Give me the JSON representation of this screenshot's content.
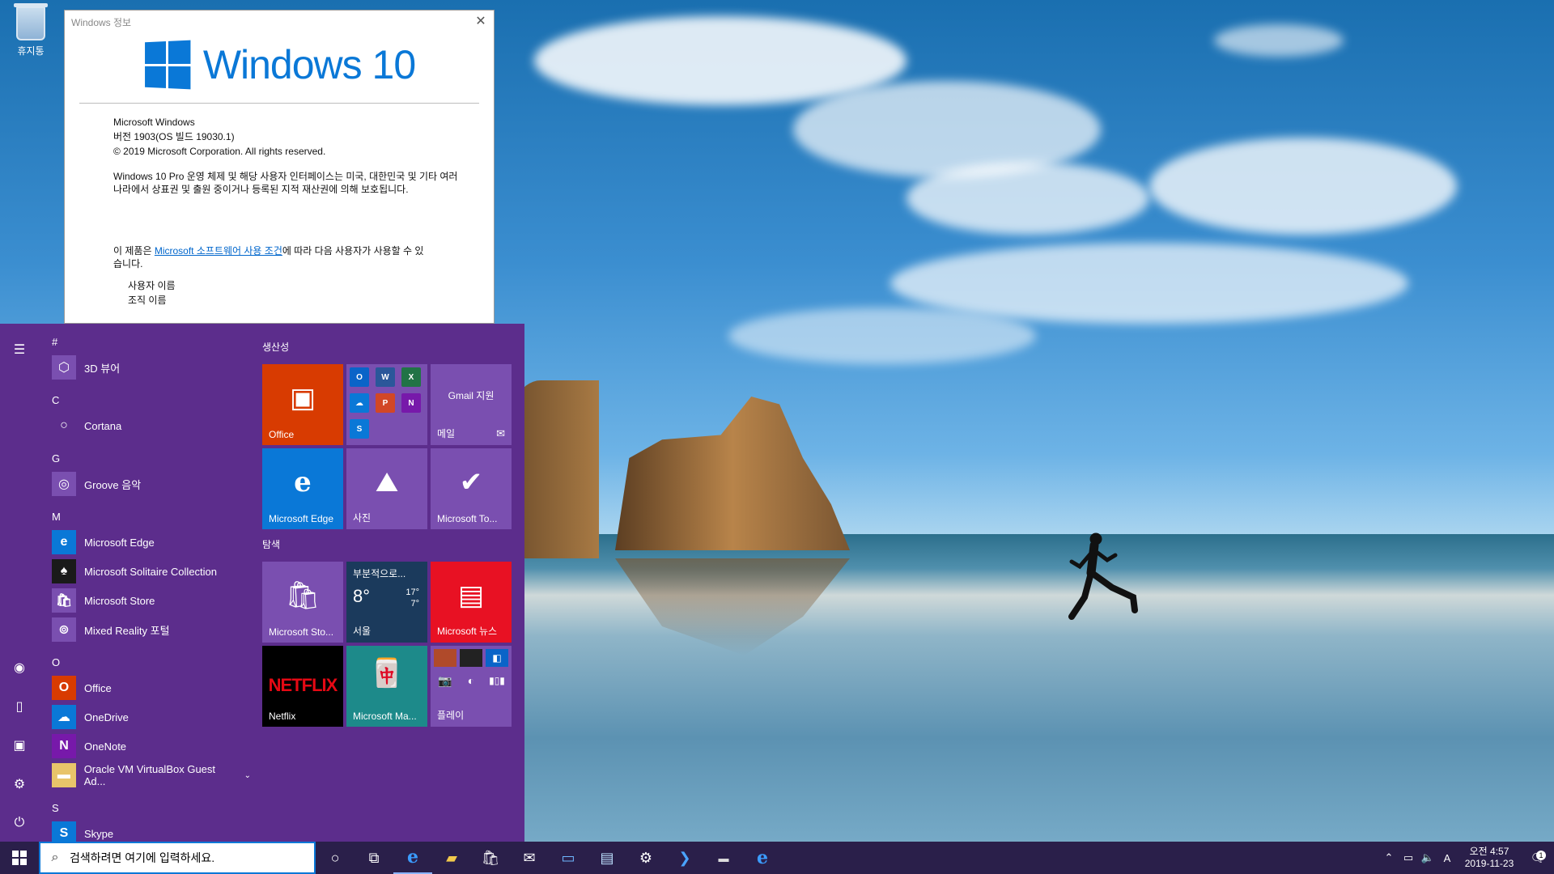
{
  "desktop": {
    "recycle_bin_label": "휴지통"
  },
  "about_window": {
    "title": "Windows 정보",
    "logo_text": "Windows 10",
    "product": "Microsoft Windows",
    "version": "버전 1903(OS 빌드 19030.1)",
    "copyright": "© 2019 Microsoft Corporation. All rights reserved.",
    "legal_text": "Windows 10 Pro 운영 체제 및 해당 사용자 인터페이스는 미국, 대한민국 및 기타 여러 나라에서 상표권 및 출원 중이거나 등록된 지적 재산권에 의해 보호됩니다.",
    "license_prefix": "이 제품은 ",
    "license_link": "Microsoft 소프트웨어 사용 조건",
    "license_suffix": "에 따라 다음 사용자가 사용할 수 있습니다.",
    "user_name_label": "사용자 이름",
    "org_name_label": "조직 이름"
  },
  "start_menu": {
    "app_list": [
      {
        "type": "letter",
        "text": "#"
      },
      {
        "type": "app",
        "name": "3D 뷰어",
        "icon": "cube-icon",
        "color": "#7a4fb0",
        "glyph": "⬡"
      },
      {
        "type": "letter",
        "text": "C"
      },
      {
        "type": "app",
        "name": "Cortana",
        "icon": "cortana-icon",
        "color": "#5c2d8c",
        "glyph": "○"
      },
      {
        "type": "letter",
        "text": "G"
      },
      {
        "type": "app",
        "name": "Groove 음악",
        "icon": "groove-icon",
        "color": "#7a4fb0",
        "glyph": "◎"
      },
      {
        "type": "letter",
        "text": "M"
      },
      {
        "type": "app",
        "name": "Microsoft Edge",
        "icon": "edge-icon",
        "color": "#0a78d7",
        "glyph": "e"
      },
      {
        "type": "app",
        "name": "Microsoft Solitaire Collection",
        "icon": "cards-icon",
        "color": "#1a1a1a",
        "glyph": "♠"
      },
      {
        "type": "app",
        "name": "Microsoft Store",
        "icon": "store-icon",
        "color": "#7a4fb0",
        "glyph": "🛍"
      },
      {
        "type": "app",
        "name": "Mixed Reality 포털",
        "icon": "headset-icon",
        "color": "#7a4fb0",
        "glyph": "⊚"
      },
      {
        "type": "letter",
        "text": "O"
      },
      {
        "type": "app",
        "name": "Office",
        "icon": "office-icon",
        "color": "#d83b01",
        "glyph": "O"
      },
      {
        "type": "app",
        "name": "OneDrive",
        "icon": "onedrive-icon",
        "color": "#0a78d7",
        "glyph": "☁"
      },
      {
        "type": "app",
        "name": "OneNote",
        "icon": "onenote-icon",
        "color": "#7719aa",
        "glyph": "N"
      },
      {
        "type": "app",
        "name": "Oracle VM VirtualBox Guest Ad...",
        "icon": "folder-icon",
        "color": "#e8c46a",
        "glyph": "▬",
        "expandable": true
      },
      {
        "type": "letter",
        "text": "S"
      },
      {
        "type": "app",
        "name": "Skype",
        "icon": "skype-icon",
        "color": "#0a78d7",
        "glyph": "S"
      }
    ],
    "groups": [
      {
        "title": "생산성"
      },
      {
        "title": "탐색"
      }
    ],
    "tiles": {
      "office": {
        "label": "Office",
        "color": "#d83b01"
      },
      "office_apps": {
        "color": "#7a4fb0",
        "minis": [
          {
            "glyph": "O",
            "color": "#0a64c8",
            "icon": "outlook-icon"
          },
          {
            "glyph": "W",
            "color": "#2b579a",
            "icon": "word-icon"
          },
          {
            "glyph": "X",
            "color": "#217346",
            "icon": "excel-icon"
          },
          {
            "glyph": "☁",
            "color": "#0a78d7",
            "icon": "onedrive-icon"
          },
          {
            "glyph": "P",
            "color": "#d24726",
            "icon": "powerpoint-icon"
          },
          {
            "glyph": "N",
            "color": "#7719aa",
            "icon": "onenote-icon"
          },
          {
            "glyph": "S",
            "color": "#0a78d7",
            "icon": "skype-icon"
          }
        ]
      },
      "mail": {
        "top": "Gmail 지원",
        "label": "메일",
        "color": "#7a4fb0"
      },
      "edge": {
        "label": "Microsoft Edge",
        "color": "#0a78d7"
      },
      "photos": {
        "label": "사진",
        "color": "#7a4fb0"
      },
      "todo": {
        "label": "Microsoft To...",
        "color": "#7a4fb0"
      },
      "store": {
        "label": "Microsoft Sto...",
        "color": "#7a4fb0"
      },
      "weather": {
        "condition": "부분적으로...",
        "temp": "8°",
        "high": "17°",
        "low": "7°",
        "label": "서울",
        "color": "#1b3a5c"
      },
      "news": {
        "label": "Microsoft 뉴스",
        "color": "#e81123"
      },
      "netflix": {
        "logo": "NETFLIX",
        "label": "Netflix",
        "color": "#000000",
        "logo_color": "#e50914"
      },
      "mahjong": {
        "label": "Microsoft Ma...",
        "color": "#1d8a8a"
      },
      "play": {
        "label": "플레이",
        "color": "#7a4fb0"
      }
    }
  },
  "taskbar": {
    "search_placeholder": "검색하려면 여기에 입력하세요.",
    "clock_time": "오전 4:57",
    "clock_date": "2019-11-23",
    "ime_indicator": "A",
    "notification_count": "1"
  }
}
